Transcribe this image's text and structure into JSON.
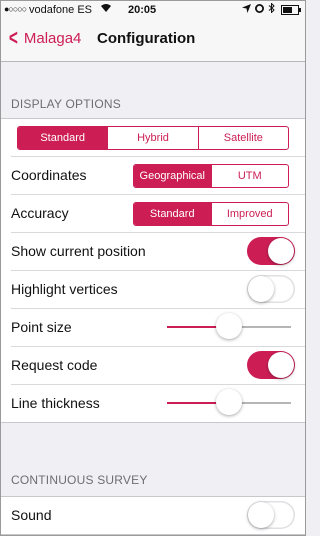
{
  "status_bar": {
    "signal": "●○○○○",
    "carrier": "vodafone ES",
    "time": "20:05"
  },
  "nav": {
    "back_label": "Malaga4",
    "title": "Configuration"
  },
  "display_options": {
    "header": "DISPLAY OPTIONS",
    "map_type": {
      "options": [
        "Standard",
        "Hybrid",
        "Satellite"
      ],
      "selected": "Standard"
    },
    "coordinates": {
      "label": "Coordinates",
      "options": [
        "Geographical",
        "UTM"
      ],
      "selected": "Geographical"
    },
    "accuracy": {
      "label": "Accuracy",
      "options": [
        "Standard",
        "Improved"
      ],
      "selected": "Standard"
    },
    "show_current_position": {
      "label": "Show current position",
      "on": true
    },
    "highlight_vertices": {
      "label": "Highlight vertices",
      "on": false
    },
    "point_size": {
      "label": "Point size",
      "value": 0.5
    },
    "request_code": {
      "label": "Request code",
      "on": true
    },
    "line_thickness": {
      "label": "Line thickness",
      "value": 0.5
    }
  },
  "continuous_survey": {
    "header": "CONTINUOUS SURVEY",
    "sound": {
      "label": "Sound",
      "on": false
    }
  },
  "colors": {
    "accent": "#cc1e55",
    "background": "#efeff4"
  }
}
